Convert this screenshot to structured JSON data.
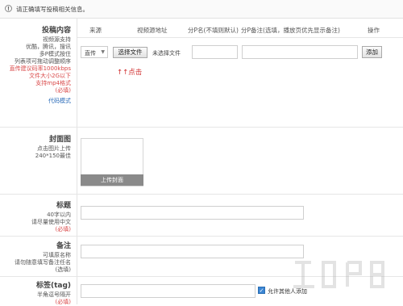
{
  "notice": {
    "icon": "info-icon",
    "text": "请正确填写投稿相关信息。"
  },
  "upload": {
    "title": "投稿内容",
    "lines": [
      "视频源支持",
      "优酷，腾讯，搜讯",
      "多P模式按住",
      "列表项可拖动调整顺序"
    ],
    "red_lines": [
      "直传建议码率1000kbps",
      "文件大小2G以下",
      "支持mp4格式",
      "(必填)"
    ],
    "code_mode": "代码模式",
    "headers": {
      "source": "来源",
      "url": "视频源地址",
      "part_name": "分P名(不填则默认)",
      "part_note": "分P备注(选填，播放页优先显示备注)",
      "action": "操作"
    },
    "source_value": "直传",
    "choose_file": "选择文件",
    "no_file": "未选择文件",
    "add": "添加",
    "hint": "↑↑点击"
  },
  "cover": {
    "title": "封面图",
    "lines": [
      "点击图片上传",
      "240*150最佳"
    ],
    "button": "上传封面"
  },
  "title_section": {
    "title": "标题",
    "lines": [
      "40字以内",
      "请尽量使用中文"
    ],
    "required": "(必填)"
  },
  "note_section": {
    "title": "备注",
    "lines": [
      "可填原名称",
      "请勿随意填写备注任名"
    ],
    "optional": "(选填)"
  },
  "tag_section": {
    "title": "标签(tag)",
    "lines": [
      "半角逗号隔开"
    ],
    "required": "(必填)",
    "checkbox_label": "允许其他人添加",
    "checkbox_checked": true
  },
  "colors": {
    "red": "#d94848",
    "blue": "#2a6bb8",
    "checkbox": "#3b86d4"
  }
}
